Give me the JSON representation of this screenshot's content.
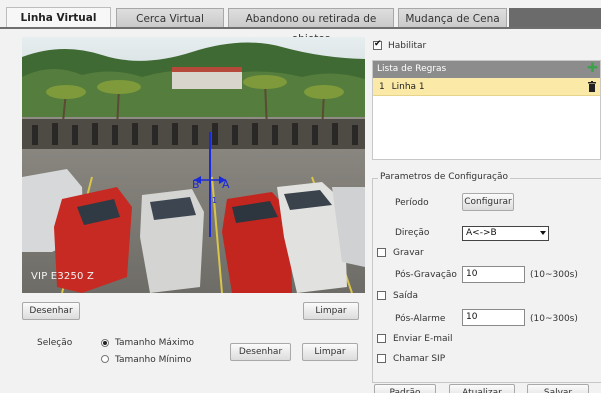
{
  "tabs": [
    {
      "label": "Linha Virtual",
      "active": true
    },
    {
      "label": "Cerca Virtual",
      "active": false
    },
    {
      "label": "Abandono ou retirada de objetos",
      "active": false
    },
    {
      "label": "Mudança de Cena",
      "active": false
    }
  ],
  "video": {
    "camera_label": "VIP E3250 Z",
    "line_label_a": "A",
    "line_label_b": "B",
    "line_number": "1"
  },
  "video_controls": {
    "draw_label": "Desenhar",
    "clear_label": "Limpar"
  },
  "selection": {
    "label": "Seleção",
    "options": [
      "Tamanho Máximo",
      "Tamanho Mínimo"
    ],
    "selected": "Tamanho Máximo",
    "draw_label": "Desenhar",
    "clear_label": "Limpar"
  },
  "enable": {
    "label": "Habilitar",
    "checked": true
  },
  "rules": {
    "title": "Lista de Regras",
    "items": [
      {
        "index": "1",
        "name": "Linha 1"
      }
    ]
  },
  "config": {
    "legend": "Parametros de Configuração",
    "period_label": "Período",
    "configure_button": "Configurar",
    "direction_label": "Direção",
    "direction_value": "A<->B",
    "record_label": "Gravar",
    "post_record_label": "Pós-Gravação",
    "post_record_value": "10",
    "post_record_range": "(10~300s)",
    "output_label": "Saída",
    "post_alarm_label": "Pós-Alarme",
    "post_alarm_value": "10",
    "post_alarm_range": "(10~300s)",
    "email_label": "Enviar E-mail",
    "sip_label": "Chamar SIP"
  },
  "footer": {
    "default_label": "Padrão",
    "refresh_label": "Atualizar",
    "save_label": "Salvar"
  },
  "colors": {
    "rule_row_bg": "#fbe9a8",
    "rules_header_bg": "#8c8c8c",
    "virtual_line": "#1a2ad8",
    "add_icon": "#3ba24a"
  }
}
